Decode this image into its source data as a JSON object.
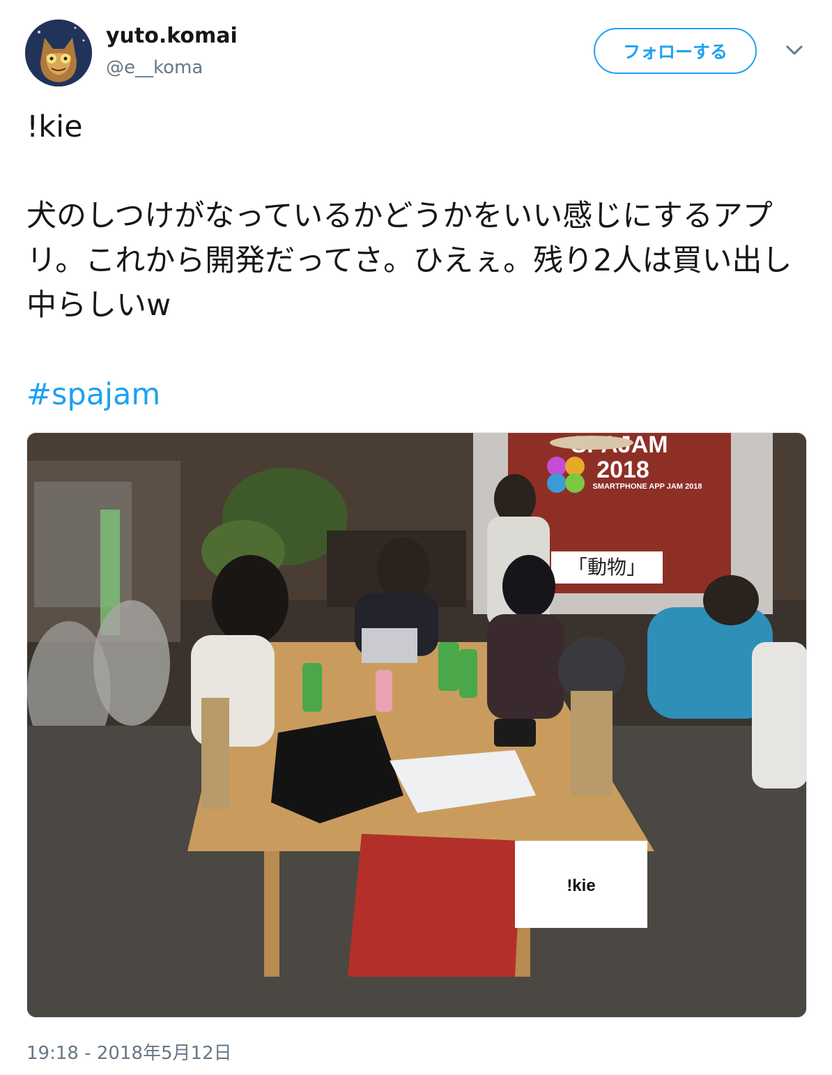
{
  "author": {
    "display_name": "yuto.komai",
    "handle": "@e__koma",
    "avatar_icon": "cat-avatar-icon"
  },
  "actions": {
    "follow_label": "フォローする",
    "more_icon": "chevron-down-icon"
  },
  "tweet": {
    "text": "!kie\n\n犬のしつけがなっているかどうかをいい感じにするアプリ。これから開発だってさ。ひえぇ。残り2人は買い出し中らしいw\n\n",
    "hashtag": "#spajam",
    "timestamp": "19:18 - 2018年5月12日"
  },
  "photo": {
    "screen_title": "SPAJAM",
    "screen_year": "2018",
    "screen_subtitle": "SMARTPHONE APP JAM 2018",
    "screen_theme": "「動物」",
    "table_sign": "!kie"
  },
  "colors": {
    "accent": "#1da1f2",
    "text": "#14171a",
    "secondary": "#657786"
  }
}
